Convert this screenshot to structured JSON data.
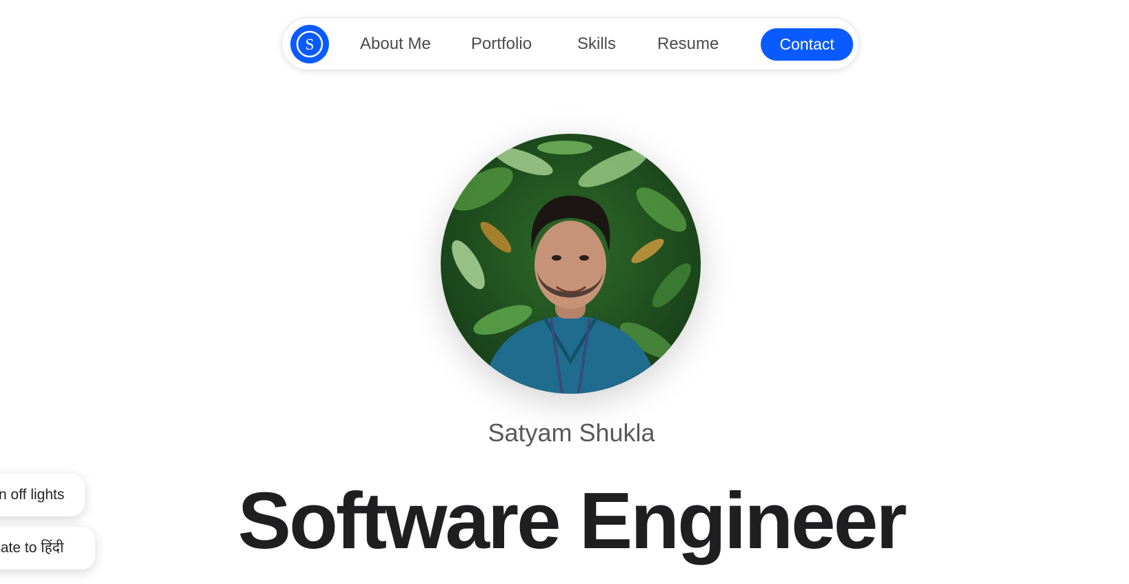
{
  "nav": {
    "logo_letter": "S",
    "links": [
      {
        "label": "About Me"
      },
      {
        "label": "Portfolio"
      },
      {
        "label": "Skills"
      },
      {
        "label": "Resume"
      }
    ],
    "cta_label": "Contact"
  },
  "hero": {
    "name": "Satyam Shukla",
    "title": "Software Engineer"
  },
  "floating": {
    "lights_label": "n off lights",
    "translate_label": "nslate to हिंदी"
  },
  "colors": {
    "accent": "#0a5bff",
    "text_dark": "#1f1f21",
    "text_muted": "#58585c",
    "background": "#ffffff"
  },
  "icons": {
    "logo": "s-logo-icon"
  }
}
